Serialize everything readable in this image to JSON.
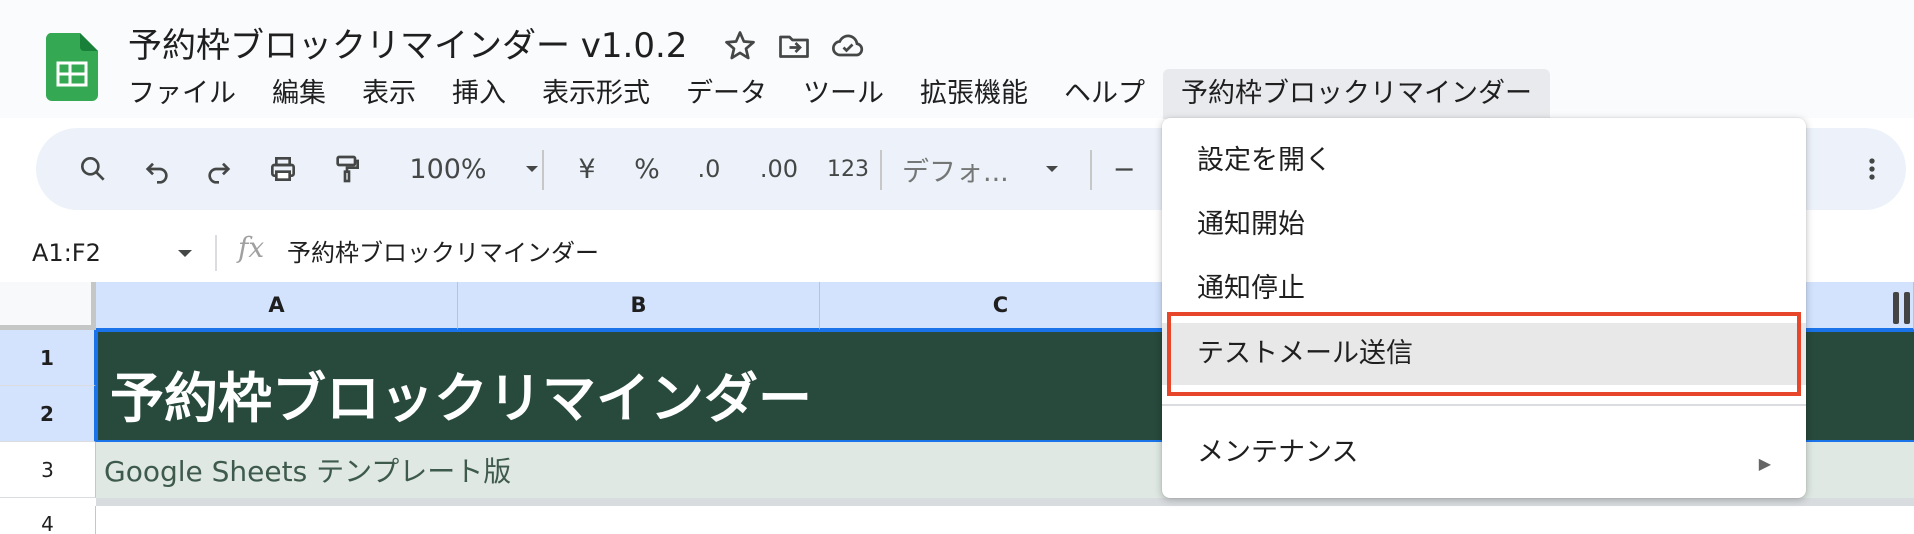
{
  "app": {
    "doc_title": "予約枠ブロックリマインダー v1.0.2",
    "brand_color": "#34a853"
  },
  "menu": {
    "items": [
      "ファイル",
      "編集",
      "表示",
      "挿入",
      "表示形式",
      "データ",
      "ツール",
      "拡張機能",
      "ヘルプ",
      "予約枠ブロックリマインダー"
    ],
    "active_index": 9
  },
  "toolbar": {
    "zoom": "100%",
    "currency": "¥",
    "percent": "%",
    "dec_decrease": ".0",
    "dec_increase": ".00",
    "number_format": "123",
    "font": "デフォ...",
    "font_minus": "−"
  },
  "formula_bar": {
    "name_box": "A1:F2",
    "fx": "fx",
    "formula": "予約枠ブロックリマインダー"
  },
  "grid": {
    "columns": [
      "A",
      "B",
      "C"
    ],
    "rows": [
      "1",
      "2",
      "3",
      "4"
    ],
    "title_cell": "予約枠ブロックリマインダー",
    "subtitle_cell": "Google Sheets テンプレート版",
    "title_bg": "#274a3c",
    "subtitle_bg": "#dfe8e3"
  },
  "dropdown": {
    "items": [
      "設定を開く",
      "通知開始",
      "通知停止",
      "テストメール送信",
      "メンテナンス"
    ],
    "highlighted_index": 3,
    "highlight_border": "#e8462a",
    "submenu_arrow": "▶"
  }
}
